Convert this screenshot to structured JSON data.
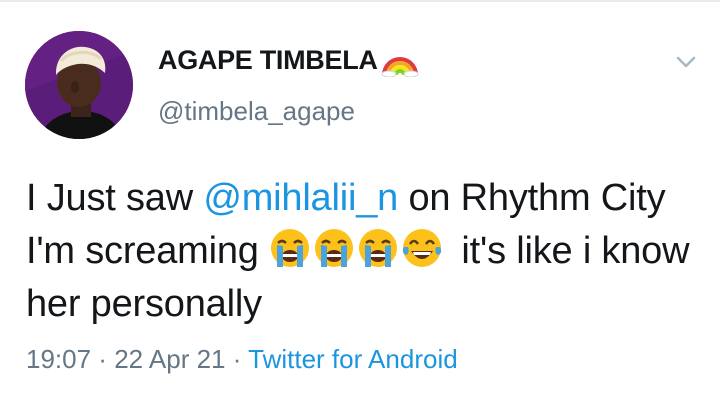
{
  "author": {
    "display_name": "AGAPE TIMBELA",
    "handle": "@timbela_agape",
    "name_badge_icon": "rainbow-icon"
  },
  "tweet": {
    "text_part1": "I Just saw ",
    "mention": "@mihlalii_n",
    "text_part2": "  on Rhythm City I'm screaming ",
    "emojis": [
      "loudly-crying-face-icon",
      "loudly-crying-face-icon",
      "loudly-crying-face-icon",
      "face-with-tears-of-joy-icon"
    ],
    "text_part3": " it's like i know her personally"
  },
  "meta": {
    "time": "19:07",
    "separator": " · ",
    "date": "22 Apr 21",
    "source": "Twitter for Android"
  },
  "menu": {
    "icon": "chevron-down-icon"
  },
  "colors": {
    "link": "#1b95e0",
    "secondary_text": "#657786",
    "avatar_bg": "#5b1d7a"
  }
}
